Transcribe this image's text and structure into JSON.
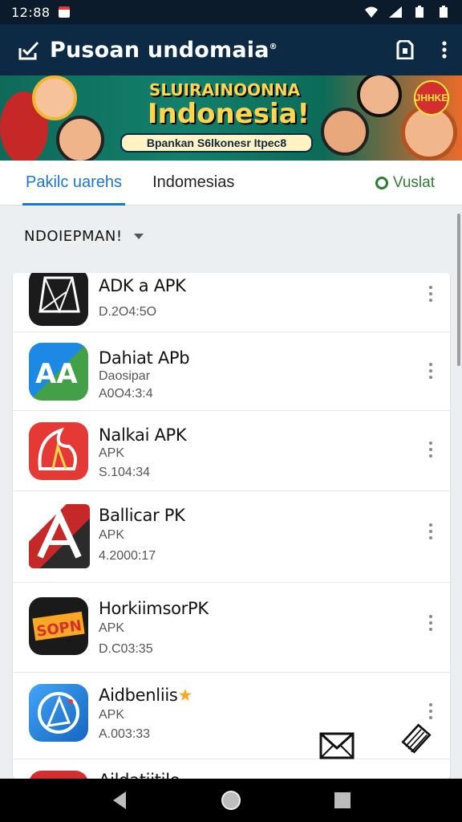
{
  "status_bar": {
    "time": "12:88"
  },
  "app_bar": {
    "title": "Pusoan undomaia",
    "title_mark": "®"
  },
  "banner": {
    "line1": "SLUIRAINOONNA",
    "line2": "Indonesia!",
    "line3": "Bpankan S6lkonesr Itpec8",
    "badge": "JHHKE"
  },
  "tabs": {
    "items": [
      {
        "label": "Pakilc uarehs",
        "active": true
      },
      {
        "label": "Indomesias",
        "active": false
      }
    ],
    "right_label": "Vuslat"
  },
  "filter": {
    "label": "NDOIEPMAN!"
  },
  "apps": [
    {
      "name": "ADK a APK",
      "sub": "",
      "version": "D.2O4:5O",
      "icon": "prism-icon"
    },
    {
      "name": "Dahiat APb",
      "sub": "Daosipar",
      "version": "A0O4:3:4",
      "icon": "aa-icon"
    },
    {
      "name": "Nalkai APK",
      "sub": "APK",
      "version": "S.104:34",
      "icon": "flame-icon"
    },
    {
      "name": "Ballicar PK",
      "sub": "APK",
      "version": "4.2000:17",
      "icon": "a-logo-icon"
    },
    {
      "name": "HorkiimsorPK",
      "sub": "APK",
      "version": "D.C03:35",
      "icon": "sopn-icon"
    },
    {
      "name": "Aidbenliis",
      "sub": "APK",
      "version": "A.003:33",
      "icon": "compass-icon"
    },
    {
      "name": "Aildatiitilo",
      "sub": "",
      "version": "",
      "icon": "red-app-icon"
    }
  ],
  "colors": {
    "app_bar": "#0d2a45",
    "accent": "#1976d2",
    "status_green": "#2e7d32"
  }
}
